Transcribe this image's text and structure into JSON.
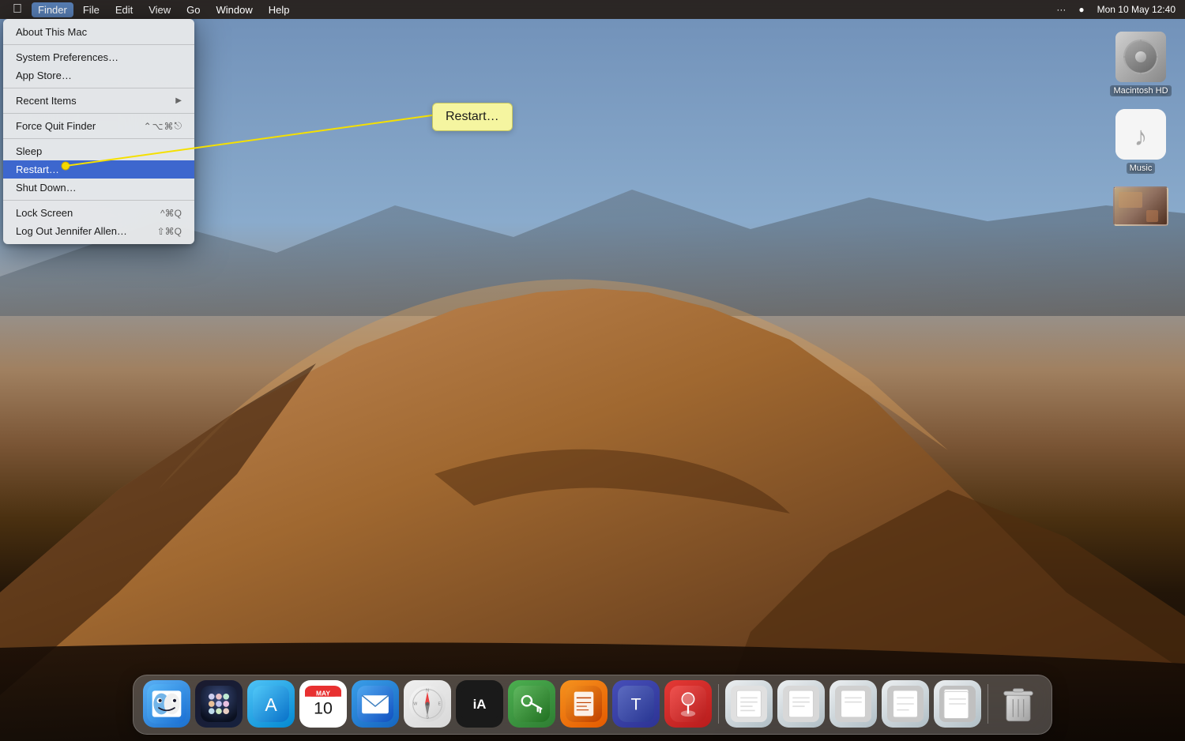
{
  "menubar": {
    "apple_label": "",
    "items": [
      {
        "label": "Finder",
        "active": false
      },
      {
        "label": "File",
        "active": false
      },
      {
        "label": "Edit",
        "active": false
      },
      {
        "label": "View",
        "active": false
      },
      {
        "label": "Go",
        "active": false
      },
      {
        "label": "Window",
        "active": false
      },
      {
        "label": "Help",
        "active": false
      }
    ],
    "right": {
      "dots": "···",
      "airdrop": "",
      "date_time": "Mon 10 May  12:40"
    }
  },
  "apple_menu": {
    "items": [
      {
        "id": "about",
        "label": "About This Mac",
        "shortcut": "",
        "has_arrow": false,
        "is_separator_before": false
      },
      {
        "id": "sep1",
        "is_separator": true
      },
      {
        "id": "system_prefs",
        "label": "System Preferences…",
        "shortcut": "",
        "has_arrow": false,
        "is_separator_before": false
      },
      {
        "id": "app_store",
        "label": "App Store…",
        "shortcut": "",
        "has_arrow": false,
        "is_separator_before": false
      },
      {
        "id": "sep2",
        "is_separator": true
      },
      {
        "id": "recent_items",
        "label": "Recent Items",
        "shortcut": "",
        "has_arrow": true,
        "is_separator_before": false
      },
      {
        "id": "sep3",
        "is_separator": true
      },
      {
        "id": "force_quit",
        "label": "Force Quit Finder",
        "shortcut": "⌃⌥⌘",
        "shortcut2": "⎋",
        "has_arrow": false
      },
      {
        "id": "sep4",
        "is_separator": true
      },
      {
        "id": "sleep",
        "label": "Sleep",
        "shortcut": "",
        "has_arrow": false
      },
      {
        "id": "restart",
        "label": "Restart…",
        "shortcut": "",
        "has_arrow": false,
        "highlighted": true
      },
      {
        "id": "shutdown",
        "label": "Shut Down…",
        "shortcut": "",
        "has_arrow": false
      },
      {
        "id": "sep5",
        "is_separator": true
      },
      {
        "id": "lock_screen",
        "label": "Lock Screen",
        "shortcut": "^⌘Q",
        "has_arrow": false
      },
      {
        "id": "logout",
        "label": "Log Out Jennifer Allen…",
        "shortcut": "⇧⌘Q",
        "has_arrow": false
      }
    ]
  },
  "restart_callout": {
    "label": "Restart…"
  },
  "desktop_icons": [
    {
      "id": "macintosh_hd",
      "label": "Macintosh HD",
      "type": "hdd"
    },
    {
      "id": "music",
      "label": "Music",
      "type": "music"
    },
    {
      "id": "screenshot",
      "label": "",
      "type": "screenshot"
    }
  ],
  "dock": {
    "icons": [
      {
        "id": "finder",
        "label": "Finder",
        "type": "finder"
      },
      {
        "id": "launchpad",
        "label": "Launchpad",
        "type": "launchpad"
      },
      {
        "id": "appstore",
        "label": "App Store",
        "type": "appstore"
      },
      {
        "id": "calendar",
        "label": "Calendar",
        "type": "calendar",
        "date_num": "10",
        "date_month": "MAY"
      },
      {
        "id": "mail",
        "label": "Mail",
        "type": "mail"
      },
      {
        "id": "safari",
        "label": "Safari",
        "type": "safari"
      },
      {
        "id": "ia_writer",
        "label": "iA Writer",
        "type": "ia"
      },
      {
        "id": "keepass",
        "label": "KeePassXC",
        "type": "keepass"
      },
      {
        "id": "pages",
        "label": "Pages",
        "type": "pages"
      },
      {
        "id": "teams",
        "label": "Teams",
        "type": "teams"
      },
      {
        "id": "joystick",
        "label": "Joystick",
        "type": "joystick"
      },
      {
        "id": "doc1",
        "label": "",
        "type": "doc"
      },
      {
        "id": "doc2",
        "label": "",
        "type": "doc"
      },
      {
        "id": "doc3",
        "label": "",
        "type": "doc"
      },
      {
        "id": "doc4",
        "label": "",
        "type": "doc"
      },
      {
        "id": "doc5",
        "label": "",
        "type": "doc"
      },
      {
        "id": "trash",
        "label": "Trash",
        "type": "trash"
      }
    ]
  }
}
